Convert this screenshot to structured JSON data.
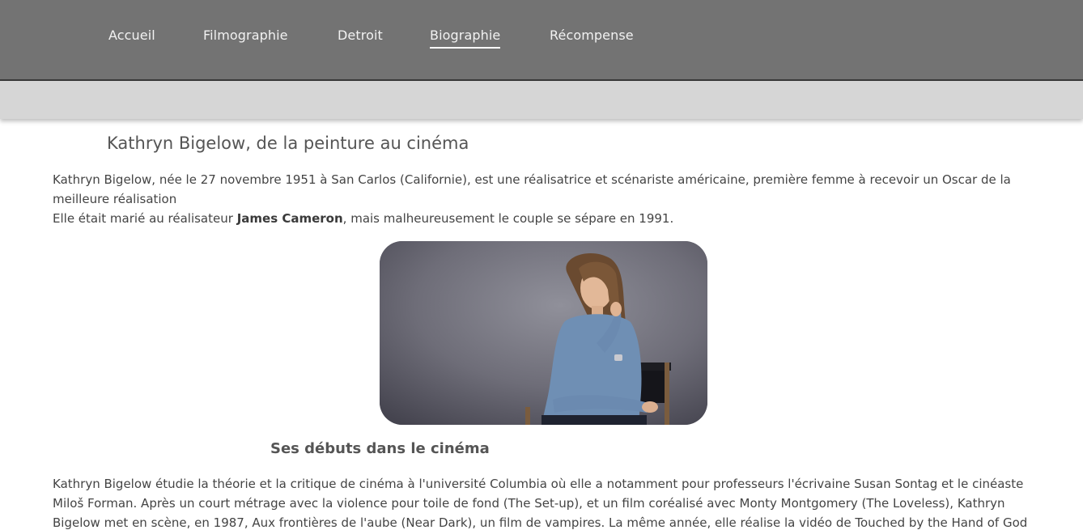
{
  "nav": {
    "items": [
      {
        "label": "Accueil"
      },
      {
        "label": "Filmographie"
      },
      {
        "label": "Detroit"
      },
      {
        "label": "Biographie",
        "active": true
      },
      {
        "label": "Récompense"
      }
    ]
  },
  "article": {
    "title": "Kathryn Bigelow, de la peinture au cinéma",
    "intro_line1": "Kathryn Bigelow, née le 27 novembre 1951 à San Carlos (Californie), est une réalisatrice et scénariste américaine, première femme à recevoir un Oscar de la meilleure réalisation",
    "intro_line2_before": "Elle était marié au réalisateur ",
    "intro_line2_bold": "James Cameron",
    "intro_line2_after": ", mais malheureusement le couple se sépare en 1991.",
    "section_title": "Ses débuts dans le cinéma",
    "section_text": "Kathryn Bigelow étudie la théorie et la critique de cinéma à l'université Columbia où elle a notamment pour professeurs l'écrivaine Susan Sontag et le cinéaste Miloš Forman. Après un court métrage avec la violence pour toile de fond (The Set-up), et un film coréalisé avec Monty Montgomery (The Loveless), Kathryn Bigelow met en scène, en 1987, Aux frontières de l'aube (Near Dark), un film de vampires. La même année, elle réalise la vidéo de Touched by the Hand of God de New Order. Elle"
  },
  "colors": {
    "nav_bg": "#737373",
    "subbar_bg": "#d6d6d6",
    "text": "#444444"
  }
}
